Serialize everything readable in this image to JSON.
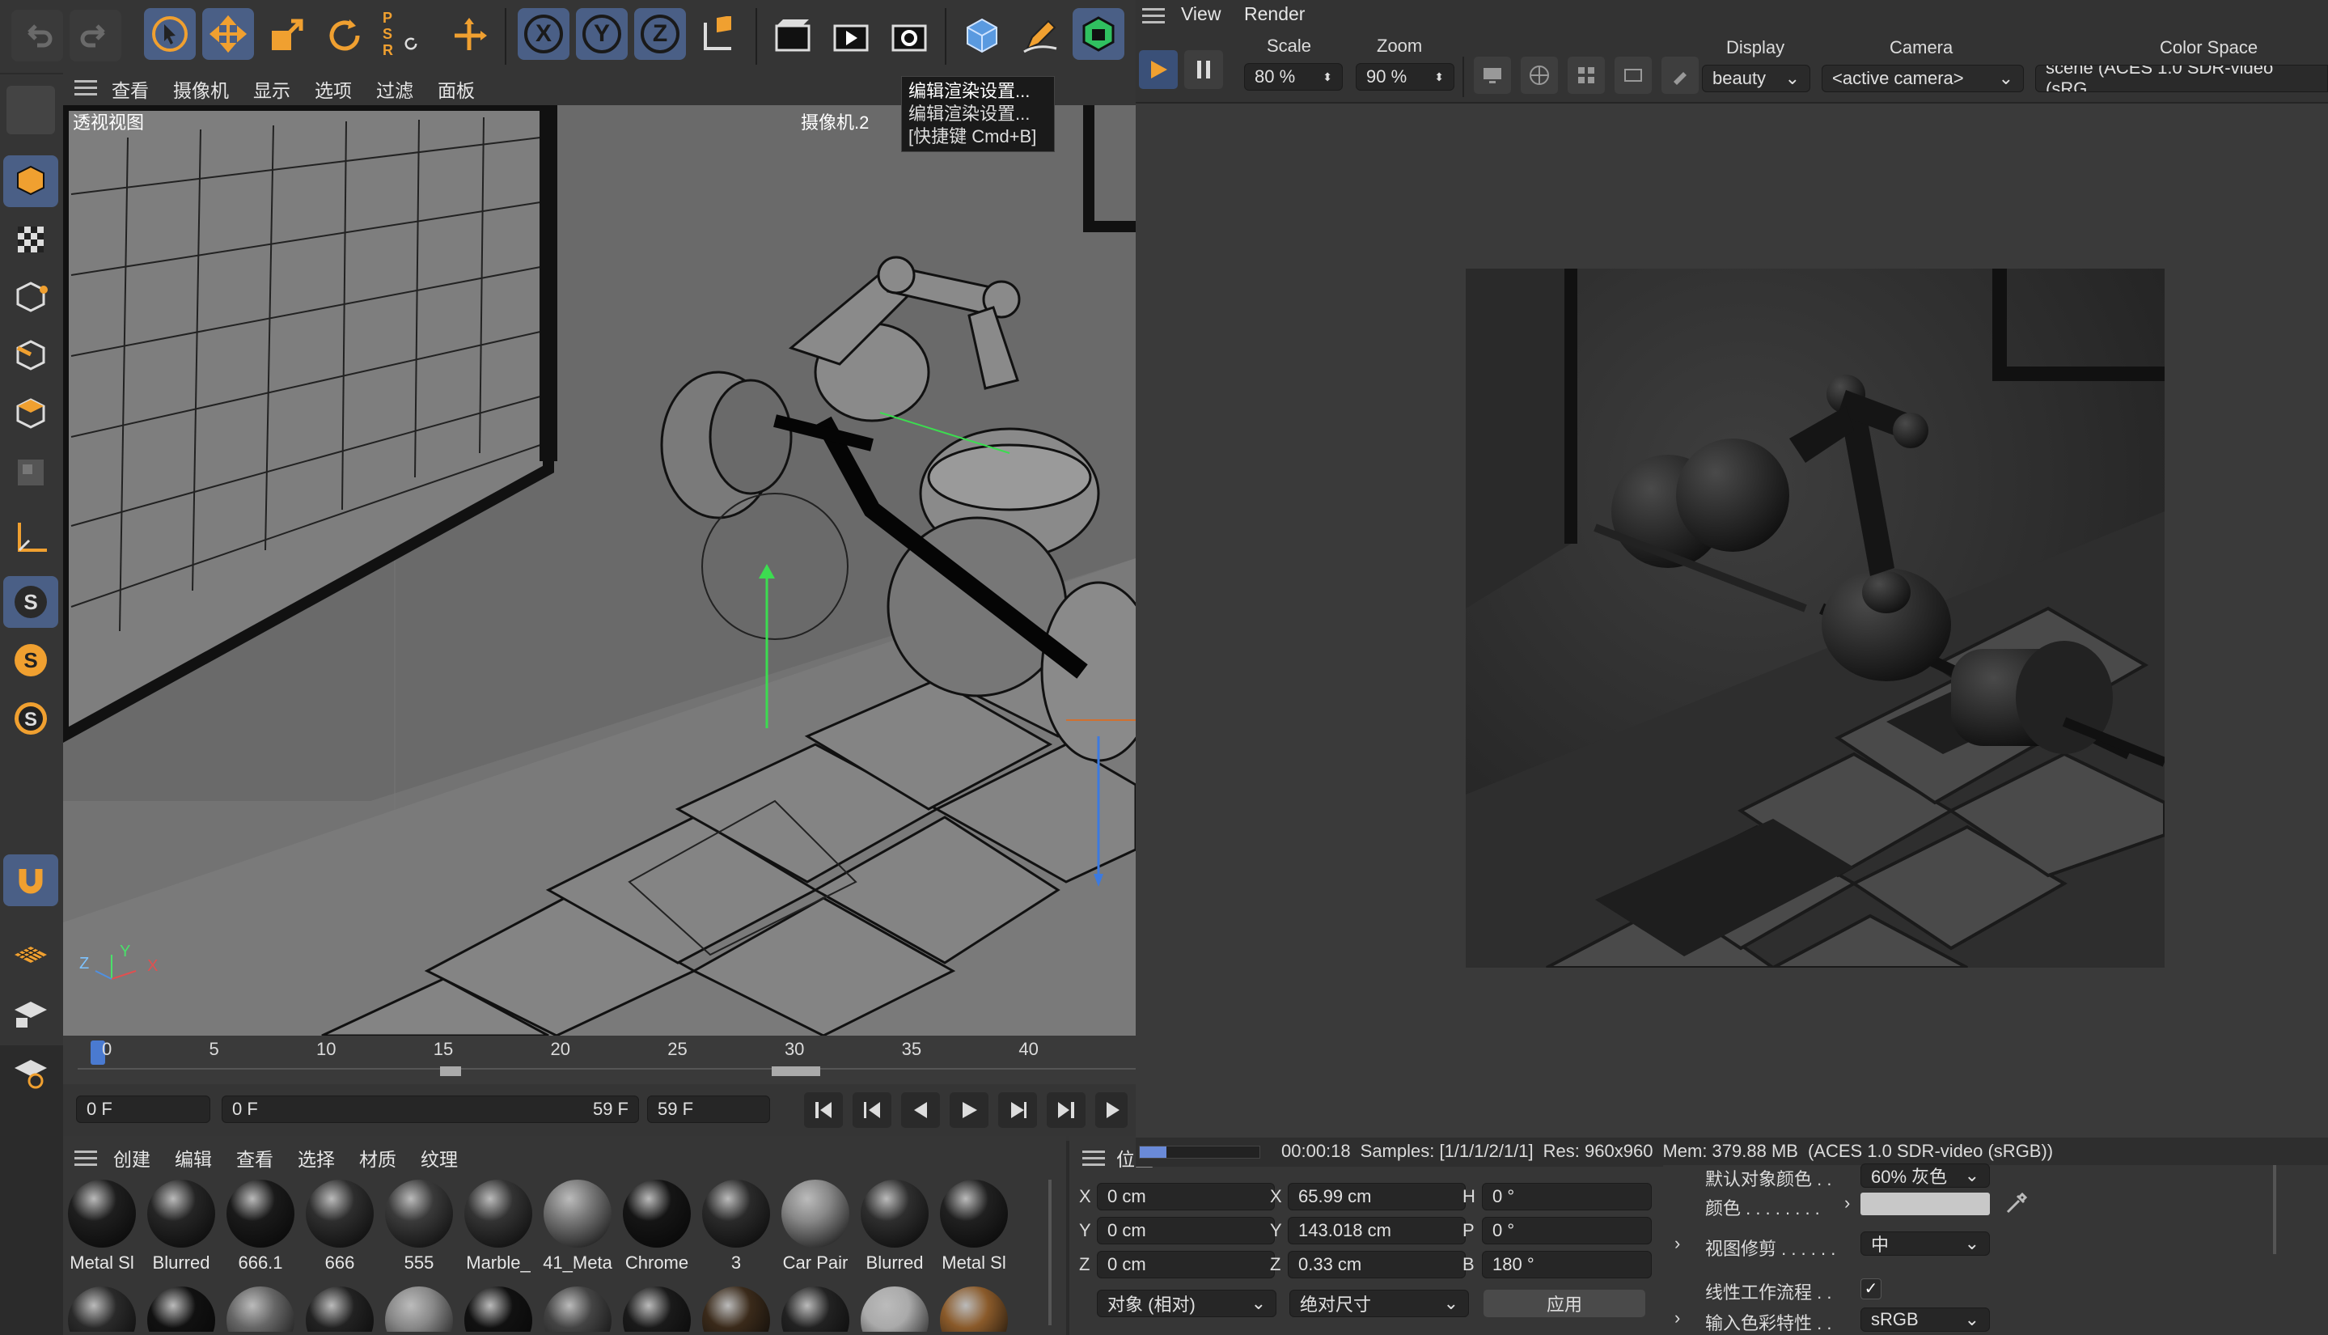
{
  "toolbar": {
    "icons": [
      "undo-icon",
      "redo-icon",
      "select-cursor-icon",
      "move-icon",
      "scale-icon",
      "rotate-icon",
      "psr-icon",
      "transform-icon",
      "x-axis-icon",
      "y-axis-icon",
      "z-axis-icon",
      "coordinate-system-icon",
      "render-region-icon",
      "render-view-icon",
      "render-settings-icon",
      "cube-icon",
      "pen-icon",
      "lock-cube-icon"
    ],
    "psr_text": "P S R",
    "axis_x": "X",
    "axis_y": "Y",
    "axis_z": "Z"
  },
  "tooltip": {
    "line1": "编辑渲染设置...",
    "line2": "编辑渲染设置...",
    "line3": "[快捷键 Cmd+B]"
  },
  "viewport": {
    "menu": [
      "查看",
      "摄像机",
      "显示",
      "选项",
      "过滤",
      "面板"
    ],
    "label": "透视视图",
    "camera": "摄像机.2"
  },
  "timeline": {
    "ticks": [
      "0",
      "5",
      "10",
      "15",
      "20",
      "25",
      "30",
      "35",
      "40"
    ],
    "current_frame": "0 F",
    "range_start": "0 F",
    "range_end": "59 F",
    "end_frame": "59 F"
  },
  "materials": {
    "menu": [
      "创建",
      "编辑",
      "查看",
      "选择",
      "材质",
      "纹理"
    ],
    "items": [
      {
        "name": "Metal Sl",
        "color": "#1e1e1e"
      },
      {
        "name": "Blurred",
        "color": "#252525"
      },
      {
        "name": "666.1",
        "color": "#1a1a1a"
      },
      {
        "name": "666",
        "color": "#2e2e2e"
      },
      {
        "name": "555",
        "color": "#3a3a3a"
      },
      {
        "name": "Marble_",
        "color": "#333"
      },
      {
        "name": "41_Meta",
        "color": "#777"
      },
      {
        "name": "Chrome",
        "color": "#151515"
      },
      {
        "name": "3",
        "color": "#2a2a2a"
      },
      {
        "name": "Car Pair",
        "color": "#888"
      },
      {
        "name": "Blurred",
        "color": "#2e2e2e"
      },
      {
        "name": "Metal Sl",
        "color": "#202020"
      }
    ],
    "row2_colors": [
      "#2a2a2a",
      "#111",
      "#666",
      "#222",
      "#888",
      "#111",
      "#444",
      "#1a1a1a",
      "#3a2a1a",
      "#222",
      "#aaa",
      "#8a5a2a"
    ]
  },
  "coords": {
    "header": "位置",
    "pos": [
      {
        "axis": "X",
        "value": "0 cm"
      },
      {
        "axis": "Y",
        "value": "0 cm"
      },
      {
        "axis": "Z",
        "value": "0 cm"
      }
    ],
    "size": [
      {
        "axis": "X",
        "value": "65.99 cm"
      },
      {
        "axis": "Y",
        "value": "143.018 cm"
      },
      {
        "axis": "Z",
        "value": "0.33 cm"
      }
    ],
    "rot": [
      {
        "axis": "H",
        "value": "0 °"
      },
      {
        "axis": "P",
        "value": "0 °"
      },
      {
        "axis": "B",
        "value": "180 °"
      }
    ],
    "mode": "对象 (相对)",
    "size_mode": "绝对尺寸",
    "apply": "应用"
  },
  "render": {
    "menu": [
      "View",
      "Render"
    ],
    "scale_label": "Scale",
    "scale": "80 %",
    "zoom_label": "Zoom",
    "zoom": "90 %",
    "display_label": "Display",
    "display": "beauty",
    "camera_label": "Camera",
    "camera": "<active camera>",
    "colorspace_label": "Color Space",
    "colorspace": "scene (ACES 1.0 SDR-video (sRG"
  },
  "status": {
    "time": "00:00:18",
    "samples": "Samples: [1/1/1/2/1/1]",
    "res": "Res: 960x960",
    "mem": "Mem: 379.88 MB",
    "cs": "(ACES 1.0 SDR-video (sRGB))"
  },
  "attributes": {
    "default_color_label": "默认对象颜色 . .",
    "default_color": "60% 灰色",
    "color_label": "颜色 . . . . . . . .",
    "clip_label": "视图修剪 . . . . . .",
    "clip": "中",
    "linear_label": "线性工作流程 . .",
    "input_cs_label": "输入色彩特性 . .",
    "input_cs": "sRGB"
  }
}
